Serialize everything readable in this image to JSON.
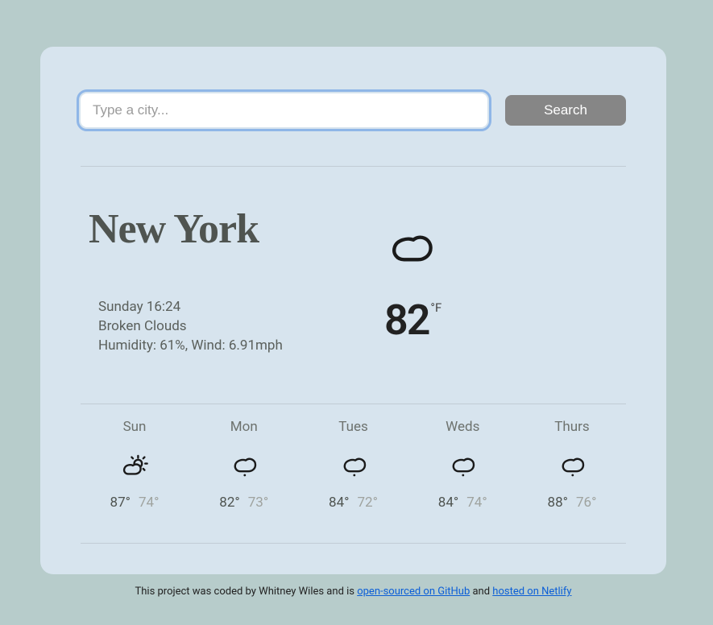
{
  "search": {
    "placeholder": "Type a city...",
    "button_label": "Search"
  },
  "current": {
    "city": "New York",
    "datetime": "Sunday 16:24",
    "condition": "Broken Clouds",
    "humidity_wind": "Humidity: 61%, Wind: 6.91mph",
    "temp": "82",
    "unit": "°F",
    "icon": "cloud-icon"
  },
  "forecast": [
    {
      "day": "Sun",
      "high": "87°",
      "low": "74°",
      "icon": "partly-sunny-icon"
    },
    {
      "day": "Mon",
      "high": "82°",
      "low": "73°",
      "icon": "rain-cloud-icon"
    },
    {
      "day": "Tues",
      "high": "84°",
      "low": "72°",
      "icon": "rain-cloud-icon"
    },
    {
      "day": "Weds",
      "high": "84°",
      "low": "74°",
      "icon": "rain-cloud-icon"
    },
    {
      "day": "Thurs",
      "high": "88°",
      "low": "76°",
      "icon": "rain-cloud-icon"
    }
  ],
  "footer": {
    "prefix": "This project was coded by Whitney Wiles and is ",
    "link1_text": "open-sourced on GitHub",
    "between": " and ",
    "link2_text": "hosted on Netlify"
  }
}
